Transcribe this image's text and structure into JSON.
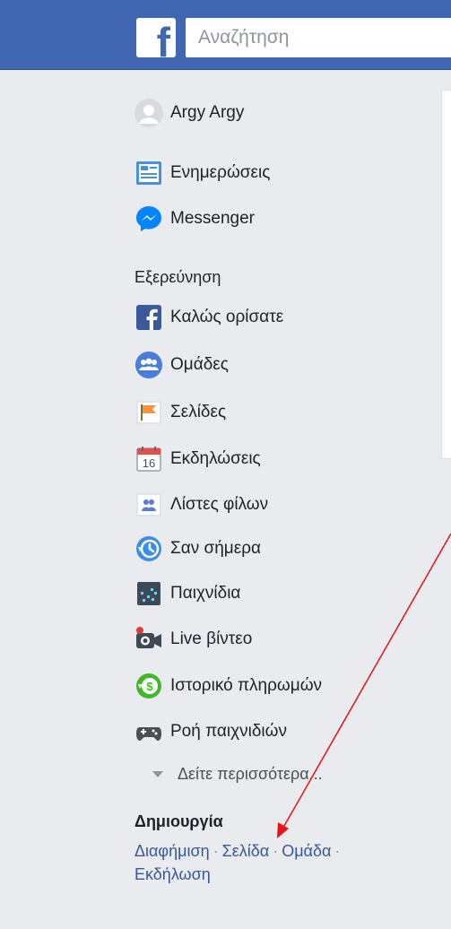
{
  "search": {
    "placeholder": "Αναζήτηση"
  },
  "user": {
    "name": "Argy Argy"
  },
  "main_items": [
    {
      "label": "Ενημερώσεις"
    },
    {
      "label": "Messenger"
    }
  ],
  "explore": {
    "title": "Εξερεύνηση",
    "items": [
      {
        "label": "Καλώς ορίσατε"
      },
      {
        "label": "Ομάδες"
      },
      {
        "label": "Σελίδες"
      },
      {
        "label": "Εκδηλώσεις",
        "icon_text": "16"
      },
      {
        "label": "Λίστες φίλων"
      },
      {
        "label": "Σαν σήμερα"
      },
      {
        "label": "Παιχνίδια"
      },
      {
        "label": "Live βίντεο"
      },
      {
        "label": "Ιστορικό πληρωμών"
      },
      {
        "label": "Ροή παιχνιδιών"
      }
    ],
    "see_more": "Δείτε περισσότερα..."
  },
  "create": {
    "title": "Δημιουργία",
    "links": [
      "Διαφήμιση",
      "Σελίδα",
      "Ομάδα",
      "Εκδήλωση"
    ],
    "separator": "·"
  },
  "colors": {
    "brand": "#4267b2",
    "link": "#365899",
    "annotation_arrow": "#e8111a"
  }
}
